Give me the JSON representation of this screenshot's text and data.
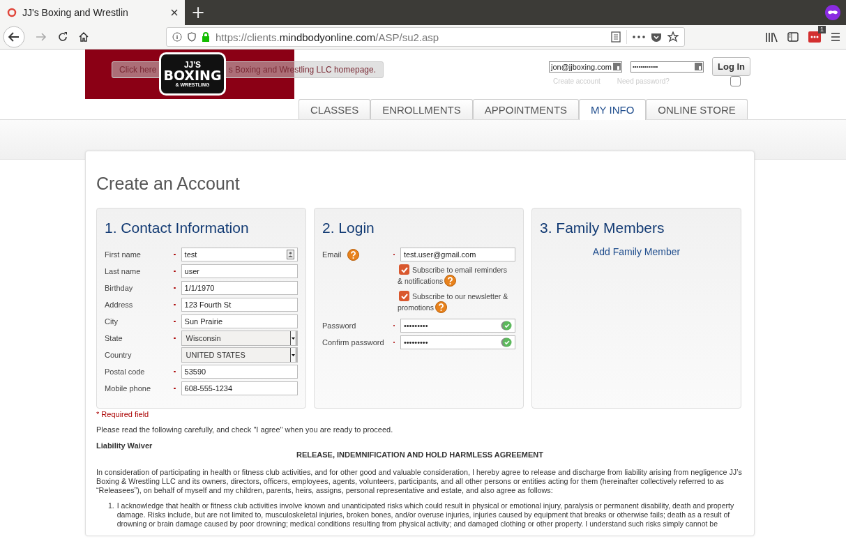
{
  "browser": {
    "tab_title": "JJ's Boxing and Wrestlin",
    "new_tab": "+",
    "url_prefix": "https://clients.",
    "url_domain": "mindbodyonline.com",
    "url_path": "/ASP/su2.asp",
    "notification_badge": "1"
  },
  "header": {
    "logo_lines": [
      "JJ'S",
      "BOXING",
      "& WRESTLING"
    ],
    "tooltip_parts": [
      "Click here",
      "s Boxing and Wrestling LLC homepage."
    ],
    "username": "jon@jjboxing.com",
    "password": "•••••••••••••",
    "login_button": "Log In",
    "create_account": "Create account",
    "need_password": "Need password?",
    "remember_checked": false
  },
  "nav_tabs": [
    {
      "label": "CLASSES",
      "selected": false
    },
    {
      "label": "ENROLLMENTS",
      "selected": false
    },
    {
      "label": "APPOINTMENTS",
      "selected": false
    },
    {
      "label": "MY INFO",
      "selected": true
    },
    {
      "label": "ONLINE STORE",
      "selected": false
    }
  ],
  "page_title": "Create an Account",
  "contact": {
    "title": "1. Contact Information",
    "fields": [
      {
        "label": "First name",
        "required": true,
        "kind": "text",
        "value": "test",
        "autofill_icon": true
      },
      {
        "label": "Last name",
        "required": true,
        "kind": "text",
        "value": "user",
        "autofill_icon": false
      },
      {
        "label": "Birthday",
        "required": true,
        "kind": "text",
        "value": "1/1/1970",
        "autofill_icon": false
      },
      {
        "label": "Address",
        "required": true,
        "kind": "text",
        "value": "123 Fourth St",
        "autofill_icon": false
      },
      {
        "label": "City",
        "required": true,
        "kind": "text",
        "value": "Sun Prairie",
        "autofill_icon": false
      },
      {
        "label": "State",
        "required": true,
        "kind": "select",
        "value": "Wisconsin"
      },
      {
        "label": "Country",
        "required": false,
        "kind": "select",
        "value": "UNITED STATES"
      },
      {
        "label": "Postal code",
        "required": true,
        "kind": "text",
        "value": "53590",
        "autofill_icon": false
      },
      {
        "label": "Mobile phone",
        "required": true,
        "kind": "text",
        "value": "608-555-1234",
        "autofill_icon": false
      }
    ]
  },
  "login": {
    "title": "2. Login",
    "email_label": "Email",
    "email_required": true,
    "email_value": "test.user@gmail.com",
    "subscriptions": [
      {
        "label": "Subscribe to email reminders",
        "label_cont": "& notifications",
        "checked": true
      },
      {
        "label": "Subscribe to our newsletter &",
        "label_cont": "promotions",
        "checked": true
      }
    ],
    "passwords": [
      {
        "label": "Password",
        "required": true,
        "value": "•••••••••",
        "valid": true
      },
      {
        "label": "Confirm password",
        "required": true,
        "value": "•••••••••",
        "valid": true
      }
    ]
  },
  "family": {
    "title": "3. Family Members",
    "add_link": "Add Family Member"
  },
  "required_note": "* Required field",
  "instructions": "Please read the following carefully, and check \"I agree\" when you are ready to proceed.",
  "waiver_heading": "Liability Waiver",
  "agreement_title": "RELEASE, INDEMNIFICATION AND HOLD HARMLESS AGREEMENT",
  "agreement_intro": "In consideration of participating in health or fitness club activities, and for other good and valuable consideration, I hereby agree to release and discharge from liability arising from negligence JJ’s Boxing & Wrestling LLC and its owners, directors, officers, employees, agents, volunteers, participants, and all other persons or entities acting for them (hereinafter collectively referred to as “Releasees”), on behalf of myself and my children, parents, heirs, assigns, personal representative and estate, and also agree as follows:",
  "agreement_items": [
    {
      "marker": "1.",
      "text": "I acknowledge that health or fitness club activities involve known and unanticipated risks which could result in physical or emotional injury, paralysis or permanent disability, death and property damage. Risks include, but are not limited to, musculoskeletal injuries, broken bones, and/or overuse injuries, injuries caused by equipment that breaks or otherwise fails; death as a result of drowning or brain damage caused by poor drowning; medical conditions resulting from physical activity; and damaged clothing or other property. I understand such risks simply cannot be"
    }
  ]
}
